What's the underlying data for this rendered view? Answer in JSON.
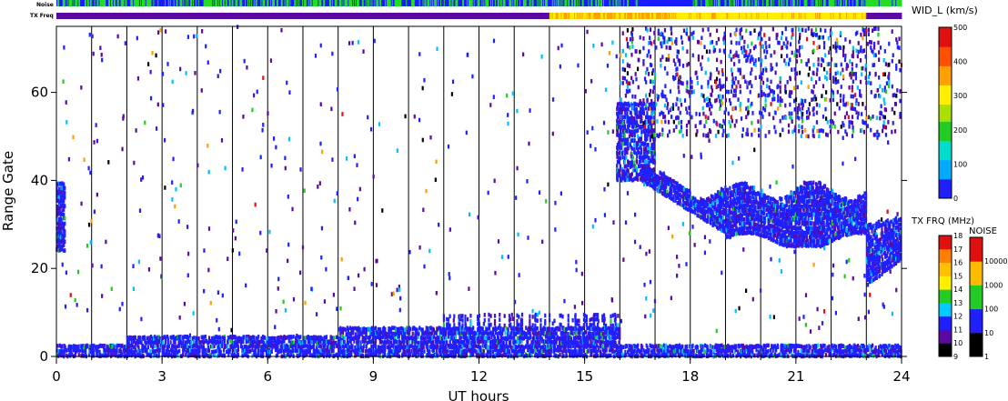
{
  "chart_data": {
    "type": "heatmap",
    "title": "",
    "xlabel": "UT hours",
    "ylabel": "Range Gate",
    "xlim": [
      0,
      24
    ],
    "ylim": [
      0,
      75
    ],
    "x_ticks": [
      0,
      3,
      6,
      9,
      12,
      15,
      18,
      21,
      24
    ],
    "y_ticks": [
      0,
      20,
      40,
      60
    ],
    "hour_gridlines": true,
    "strips": {
      "noise_label": "Noise",
      "txfreq_label": "TX Freq",
      "noise_segments": [
        {
          "from": 0,
          "to": 16.5,
          "level": "green-blue mixed"
        },
        {
          "from": 16.5,
          "to": 18.0,
          "level": "blue"
        },
        {
          "from": 18.0,
          "to": 23.0,
          "level": "green-blue mixed"
        },
        {
          "from": 23.0,
          "to": 24,
          "level": "green"
        }
      ],
      "txfreq_segments": [
        {
          "from": 0,
          "to": 14.0,
          "mhz": 10
        },
        {
          "from": 14.0,
          "to": 17.5,
          "mhz": 14.5
        },
        {
          "from": 17.5,
          "to": 23.0,
          "mhz": 14
        },
        {
          "from": 23.0,
          "to": 24,
          "mhz": 10
        }
      ]
    },
    "colorbars": {
      "width": {
        "label": "WID_L (km/s)",
        "ticks": [
          "0",
          "100",
          "200",
          "300",
          "400",
          "500"
        ]
      },
      "txfreq": {
        "label": "TX FRQ (MHz)",
        "ticks": [
          "9",
          "10",
          "11",
          "12",
          "13",
          "14",
          "15",
          "16",
          "17",
          "18"
        ]
      },
      "noise": {
        "label": "NOISE",
        "ticks": [
          "1",
          "10",
          "100",
          "1000",
          "10000"
        ]
      }
    },
    "regions": [
      {
        "name": "near-range band",
        "x": [
          0,
          24
        ],
        "gate": [
          0,
          5
        ],
        "width_kms": 80
      },
      {
        "name": "early-morning patch",
        "x": [
          0,
          0.25
        ],
        "gate": [
          24,
          40
        ],
        "width_kms": 70
      },
      {
        "name": "evening band",
        "x": [
          16.6,
          23.0
        ],
        "gate": [
          25,
          44
        ],
        "width_kms": 70
      },
      {
        "name": "evening high range",
        "x": [
          15.9,
          17.0
        ],
        "gate": [
          40,
          58
        ],
        "width_kms": 75
      },
      {
        "name": "late patch",
        "x": [
          23.0,
          24
        ],
        "gate": [
          16,
          32
        ],
        "width_kms": 75
      },
      {
        "name": "scattered far-range",
        "x": [
          16.0,
          24
        ],
        "gate": [
          50,
          75
        ],
        "width_kms": 60
      }
    ],
    "colors": {
      "low": "#2020ff",
      "mid": "#00c0ff",
      "green": "#22cc22",
      "yellow": "#ffee00",
      "orange": "#ffa000",
      "red": "#e01010",
      "purple": "#5a0aa0"
    }
  }
}
